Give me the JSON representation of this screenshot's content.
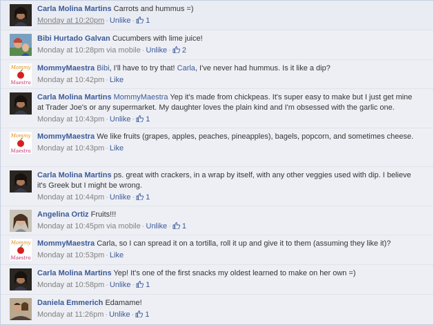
{
  "close_icon": "close-icon",
  "comments": [
    {
      "author": "Carla Molina Martins",
      "mention": "",
      "text": "Carrots and hummus =)",
      "time": "Monday at 10:20pm",
      "via": "",
      "action": "Unlike",
      "likes": "1",
      "avatar": "carla"
    },
    {
      "author": "Bibi Hurtado Galvan",
      "mention": "",
      "text": "Cucumbers with lime juice!",
      "time": "Monday at 10:28pm",
      "via": "via mobile",
      "action": "Unlike",
      "likes": "2",
      "avatar": "bibi"
    },
    {
      "author": "MommyMaestra",
      "mention": "Bibi",
      "text": ", I'll have to try that! ",
      "mention2": "Carla",
      "text2": ", I've never had hummus. Is it like a dip?",
      "time": "Monday at 10:42pm",
      "via": "",
      "action": "Like",
      "likes": "",
      "avatar": "mommy"
    },
    {
      "author": "Carla Molina Martins",
      "mention": "MommyMaestra",
      "text": "Yep it's made from chickpeas. It's super easy to make but I just get mine at Trader Joe's or any supermarket. My daughter loves the plain kind and I'm obsessed with the garlic one.",
      "time": "Monday at 10:43pm",
      "via": "",
      "action": "Unlike",
      "likes": "1",
      "avatar": "carla"
    },
    {
      "author": "MommyMaestra",
      "mention": "",
      "text": "We like fruits (grapes, apples, peaches, pineapples), bagels, popcorn, and sometimes cheese.",
      "time": "Monday at 10:43pm",
      "via": "",
      "action": "Like",
      "likes": "",
      "avatar": "mommy"
    },
    {
      "author": "Carla Molina Martins",
      "mention": "",
      "text": "ps. great with crackers, in a wrap by itself, with any other veggies used with dip. I believe it's Greek but I might be wrong.",
      "time": "Monday at 10:44pm",
      "via": "",
      "action": "Unlike",
      "likes": "1",
      "avatar": "carla"
    },
    {
      "author": "Angelina Ortiz",
      "mention": "",
      "text": "Fruits!!!",
      "time": "Monday at 10:45pm",
      "via": "via mobile",
      "action": "Unlike",
      "likes": "1",
      "avatar": "angelina"
    },
    {
      "author": "MommyMaestra",
      "mention": "",
      "text": "Carla, so I can spread it on a tortilla, roll it up and give it to them (assuming they like it)?",
      "time": "Monday at 10:53pm",
      "via": "",
      "action": "Like",
      "likes": "",
      "avatar": "mommy"
    },
    {
      "author": "Carla Molina Martins",
      "mention": "",
      "text": "Yep! It's one of the first snacks my oldest learned to make on her own =)",
      "time": "Monday at 10:58pm",
      "via": "",
      "action": "Unlike",
      "likes": "1",
      "avatar": "carla"
    },
    {
      "author": "Daniela Emmerich",
      "mention": "",
      "text": "Edamame!",
      "time": "Monday at 11:26pm",
      "via": "",
      "action": "Unlike",
      "likes": "1",
      "avatar": "daniela"
    }
  ],
  "separator": "·",
  "avatar_labels": {
    "mommy_top": "Mommy",
    "mommy_bottom": "Maestra"
  }
}
